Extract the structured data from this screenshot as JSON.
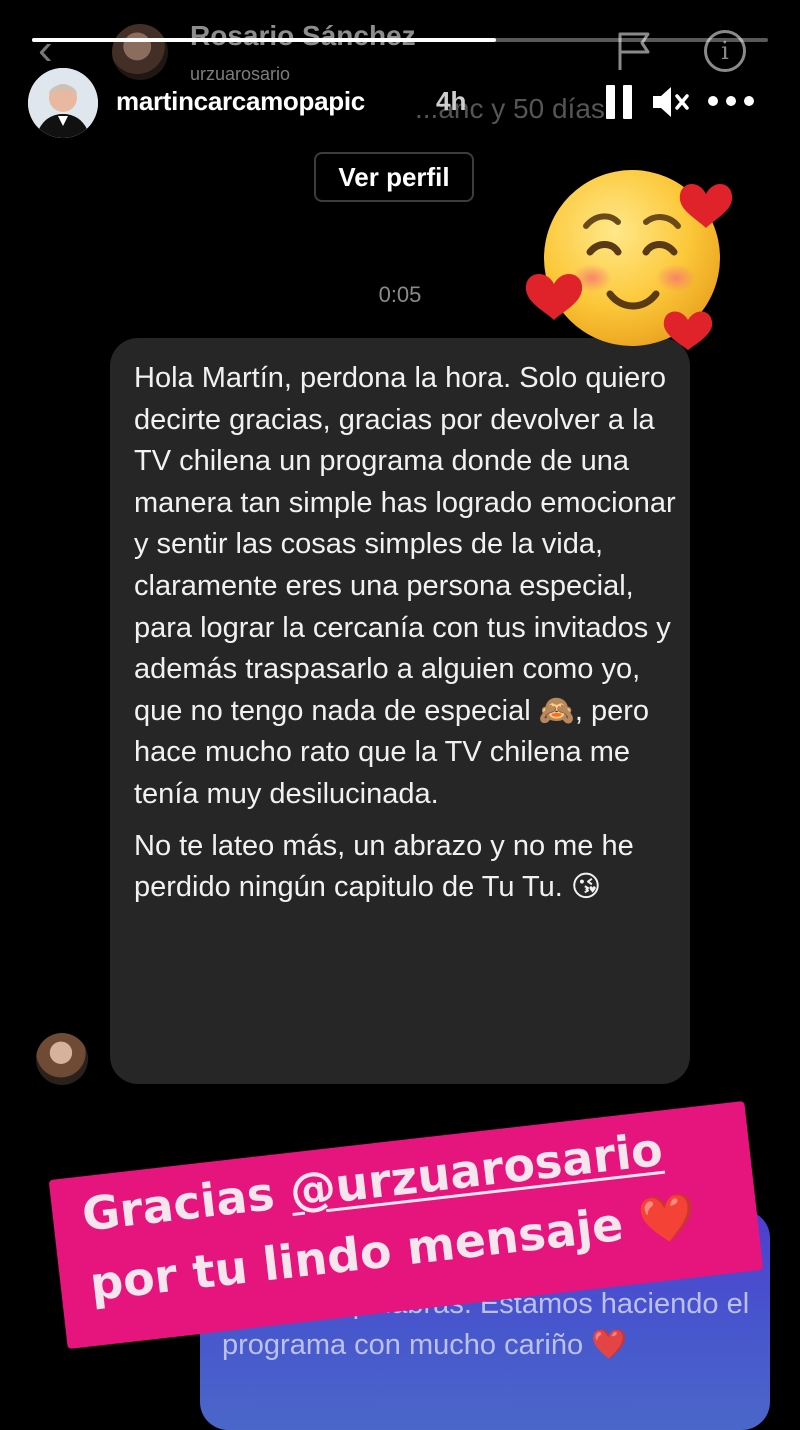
{
  "dm": {
    "contact_name": "Rosario Sánchez",
    "contact_handle": "urzuarosario",
    "ghost_text": "...anc y 50 días",
    "view_profile_label": "Ver perfil",
    "timestamp": "0:05",
    "message_paragraph_1": "Hola Martín, perdona la hora. Solo quiero decirte gracias, gracias por devolver a la TV chilena un programa donde de una manera tan simple has logrado emocionar y sentir las cosas simples de la vida, claramente eres una persona especial, para lograr la cercanía con tus invitados y además traspasarlo a alguien como yo, que no tengo nada de especial 🙈, pero hace mucho rato que la TV chilena me tenía muy desilucinada.",
    "message_paragraph_2": "No te lateo más, un abrazo y no me he perdido ningún capitulo de Tu  Tu. 😘",
    "reply_text": "...el tiempo de escribirme y gracias por tus lindas palabras. Estamos haciendo el programa con mucho cariño ❤️",
    "reply_bubble_color": "#4b5bcd",
    "incoming_bubble_color": "#262626"
  },
  "story": {
    "username": "martincarcamopapic",
    "time_ago": "4h",
    "progress": 0.63,
    "banner_prefix": "Gracias ",
    "banner_mention": "@urzuarosario",
    "banner_line2": "por tu lindo mensaje",
    "banner_heart": "❤️",
    "banner_color": "#e6147d",
    "sticker": "smiling-face-with-hearts"
  },
  "icons": {
    "back": "chevron-left-icon",
    "flag": "flag-icon",
    "info": "info-icon",
    "pause": "pause-icon",
    "mute": "speaker-muted-icon",
    "more": "more-horizontal-icon"
  }
}
